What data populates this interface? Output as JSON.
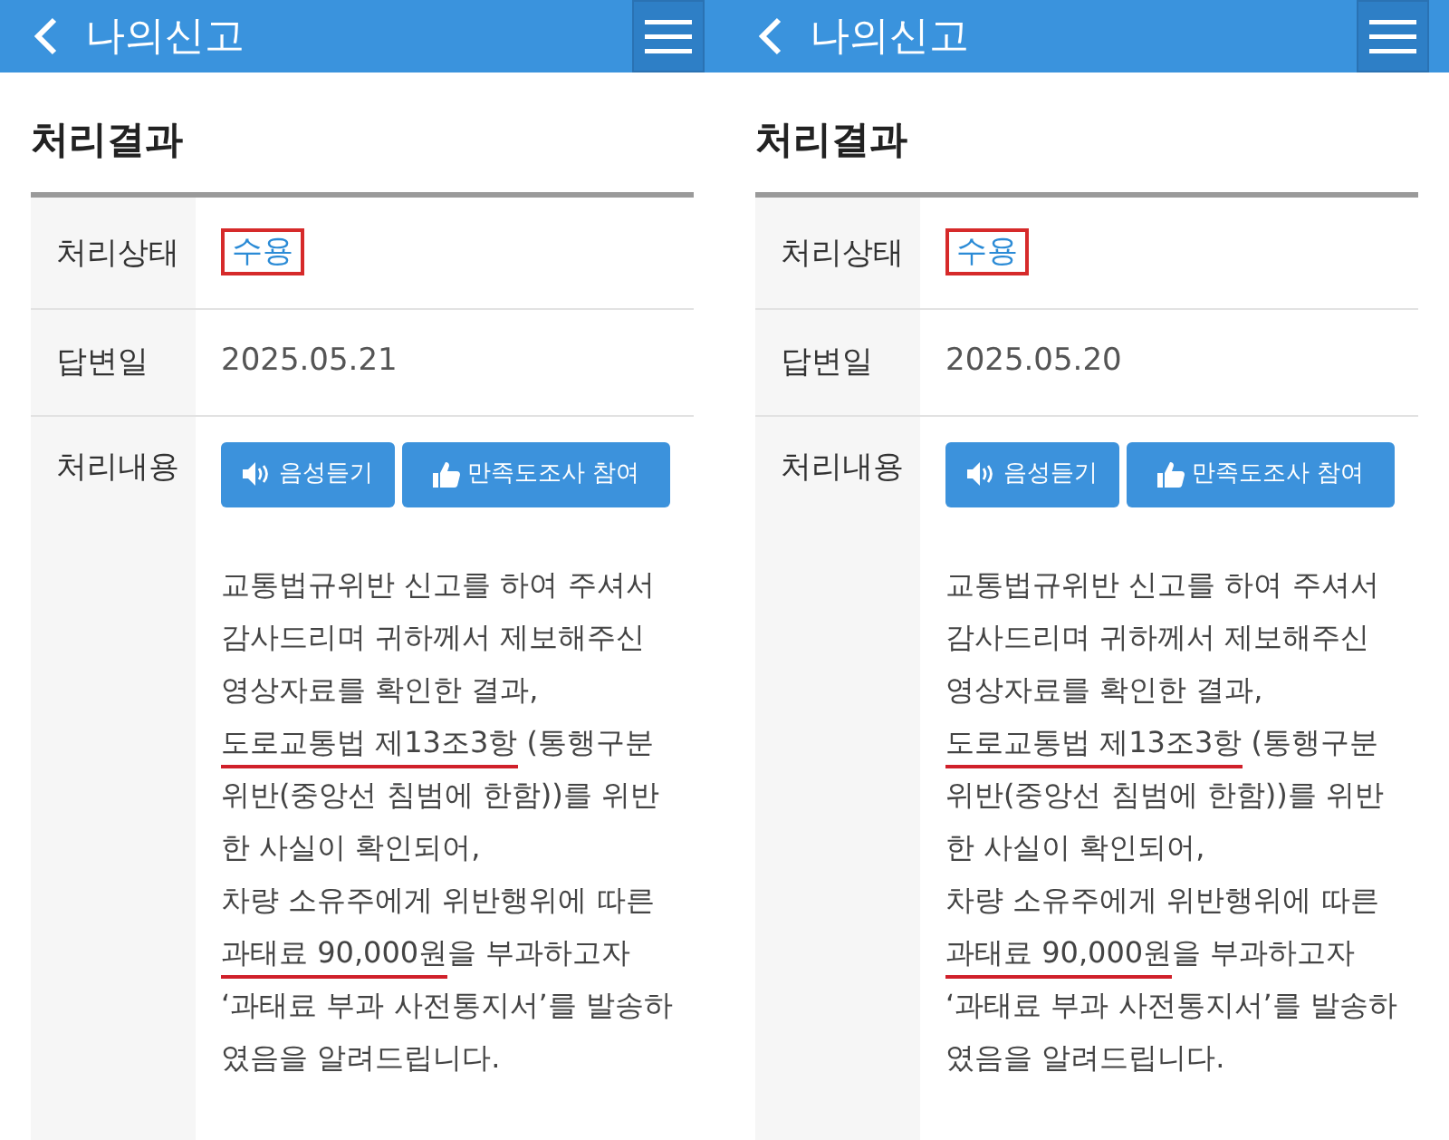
{
  "screens": [
    {
      "header": {
        "title": "나의신고"
      },
      "section_title": "처리결과",
      "rows": [
        {
          "kind": "status",
          "label": "처리상태",
          "value": "수용",
          "highlighted": true
        },
        {
          "kind": "text",
          "label": "답변일",
          "value": "2025.05.21"
        },
        {
          "kind": "content",
          "label": "처리내용",
          "buttons": [
            {
              "kind": "audio",
              "label": "음성듣기"
            },
            {
              "kind": "survey",
              "label": "만족도조사 참여"
            }
          ],
          "lines": [
            [
              {
                "text": "교통법규위반 신고를 하여 주셔서",
                "underlined": false
              }
            ],
            [
              {
                "text": "감사드리며 귀하께서 제보해주신",
                "underlined": false
              }
            ],
            [
              {
                "text": "영상자료를 확인한 결과,",
                "underlined": false
              }
            ],
            [
              {
                "text": "도로교통법 제13조3항",
                "underlined": true
              },
              {
                "text": " (통행구분",
                "underlined": false
              }
            ],
            [
              {
                "text": "위반(중앙선 침범에 한함))를 위반",
                "underlined": false
              }
            ],
            [
              {
                "text": "한 사실이 확인되어,",
                "underlined": false
              }
            ],
            [
              {
                "text": "차량 소유주에게 위반행위에 따른",
                "underlined": false
              }
            ],
            [
              {
                "text": "과태료 90,000원",
                "underlined": true
              },
              {
                "text": "을 부과하고자",
                "underlined": false
              }
            ],
            [
              {
                "text": "‘과태료 부과 사전통지서’를 발송하",
                "underlined": false
              }
            ],
            [
              {
                "text": "였음을 알려드립니다.",
                "underlined": false
              }
            ]
          ]
        }
      ]
    },
    {
      "header": {
        "title": "나의신고"
      },
      "section_title": "처리결과",
      "rows": [
        {
          "kind": "status",
          "label": "처리상태",
          "value": "수용",
          "highlighted": true
        },
        {
          "kind": "text",
          "label": "답변일",
          "value": "2025.05.20"
        },
        {
          "kind": "content",
          "label": "처리내용",
          "buttons": [
            {
              "kind": "audio",
              "label": "음성듣기"
            },
            {
              "kind": "survey",
              "label": "만족도조사 참여"
            }
          ],
          "lines": [
            [
              {
                "text": "교통법규위반 신고를 하여 주셔서",
                "underlined": false
              }
            ],
            [
              {
                "text": "감사드리며 귀하께서 제보해주신",
                "underlined": false
              }
            ],
            [
              {
                "text": "영상자료를 확인한 결과,",
                "underlined": false
              }
            ],
            [
              {
                "text": "도로교통법 제13조3항",
                "underlined": true
              },
              {
                "text": " (통행구분",
                "underlined": false
              }
            ],
            [
              {
                "text": "위반(중앙선 침범에 한함))를 위반",
                "underlined": false
              }
            ],
            [
              {
                "text": "한 사실이 확인되어,",
                "underlined": false
              }
            ],
            [
              {
                "text": "차량 소유주에게 위반행위에 따른",
                "underlined": false
              }
            ],
            [
              {
                "text": "과태료 90,000원",
                "underlined": true
              },
              {
                "text": "을 부과하고자",
                "underlined": false
              }
            ],
            [
              {
                "text": "‘과태료 부과 사전통지서’를 발송하",
                "underlined": false
              }
            ],
            [
              {
                "text": "였음을 알려드립니다.",
                "underlined": false
              }
            ]
          ]
        }
      ]
    }
  ]
}
